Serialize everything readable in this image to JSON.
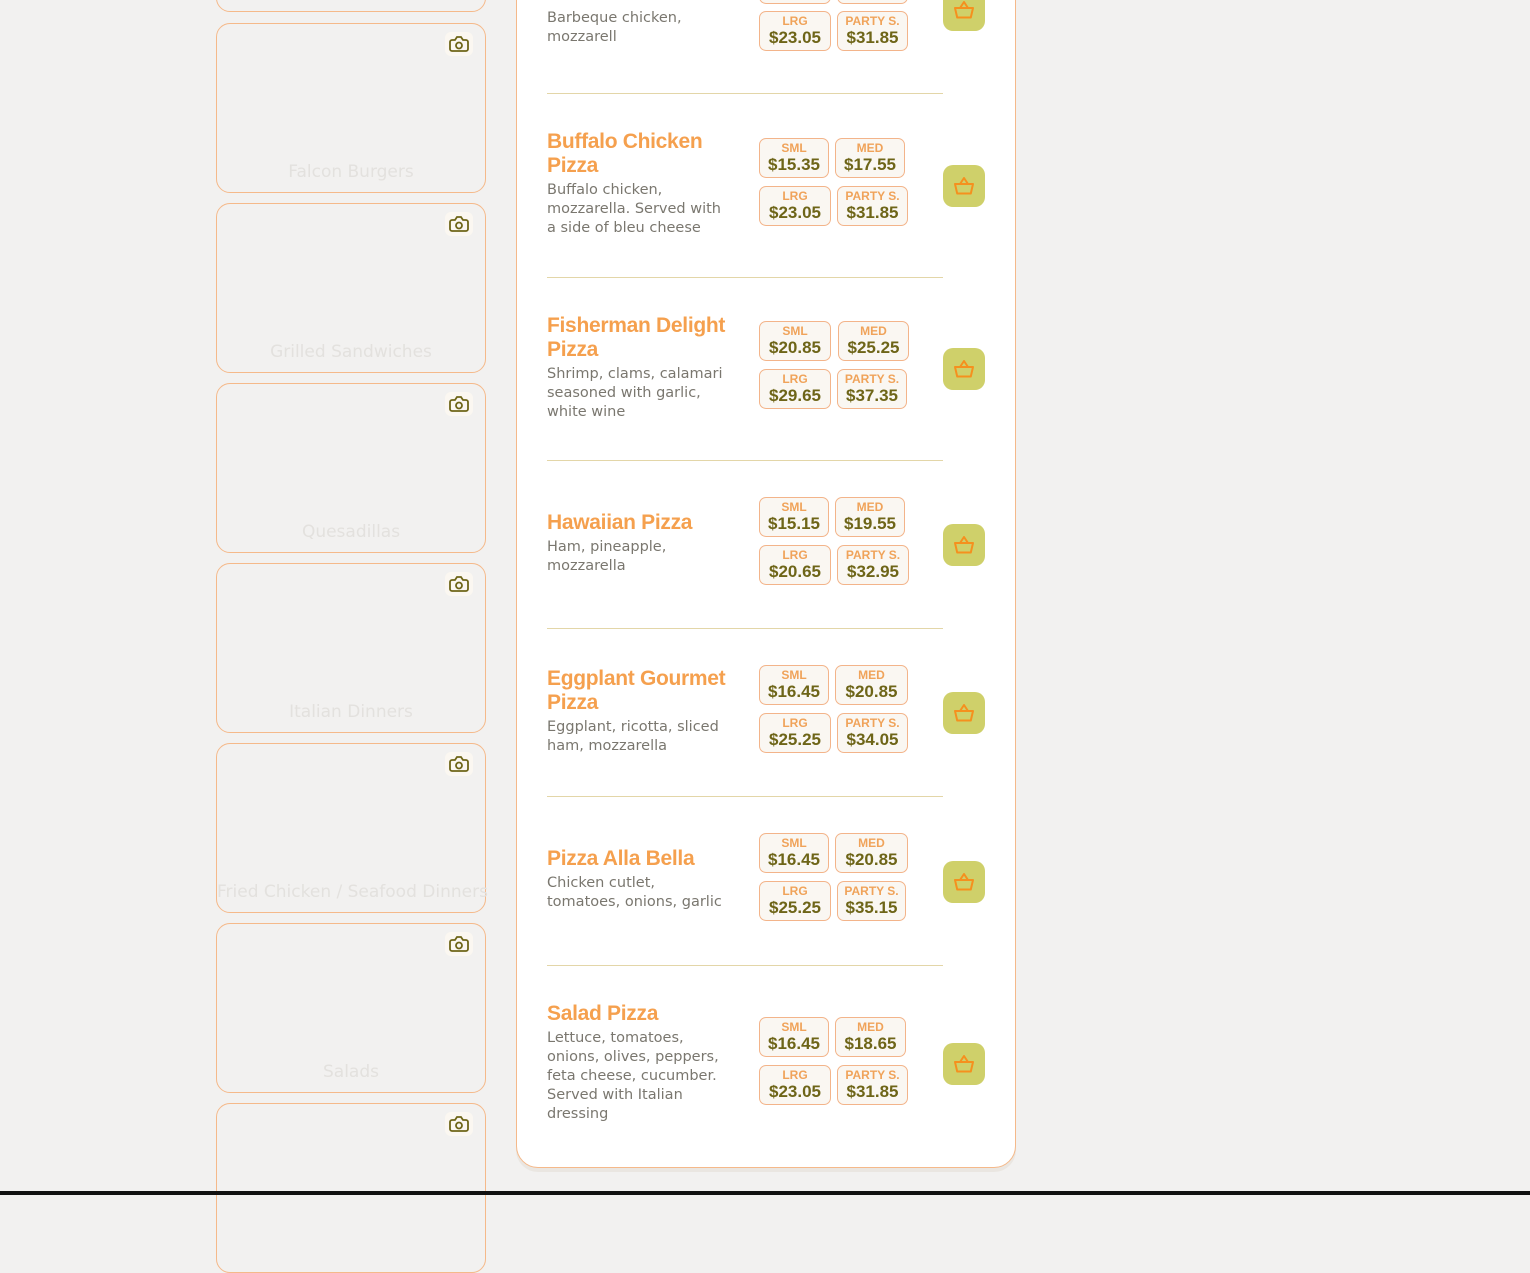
{
  "categories": [
    {
      "label": ""
    },
    {
      "label": "Falcon Burgers"
    },
    {
      "label": "Grilled Sandwiches"
    },
    {
      "label": "Quesadillas"
    },
    {
      "label": "Italian Dinners"
    },
    {
      "label": "Fried Chicken / Seafood Dinners"
    },
    {
      "label": "Salads"
    },
    {
      "label": ""
    }
  ],
  "menu_items": [
    {
      "name": "",
      "description": "Barbeque chicken, mozzarell",
      "prices": [
        {
          "size": "LRG",
          "price": "$23.05"
        },
        {
          "size": "PARTY S.",
          "price": "$31.85"
        }
      ]
    },
    {
      "name": "Buffalo Chicken Pizza",
      "description": "Buffalo chicken, mozzarella. Served with a side of bleu cheese",
      "prices": [
        {
          "size": "SML",
          "price": "$15.35"
        },
        {
          "size": "MED",
          "price": "$17.55"
        },
        {
          "size": "LRG",
          "price": "$23.05"
        },
        {
          "size": "PARTY S.",
          "price": "$31.85"
        }
      ]
    },
    {
      "name": "Fisherman Delight Pizza",
      "description": "Shrimp, clams, calamari seasoned with garlic, white wine",
      "prices": [
        {
          "size": "SML",
          "price": "$20.85"
        },
        {
          "size": "MED",
          "price": "$25.25"
        },
        {
          "size": "LRG",
          "price": "$29.65"
        },
        {
          "size": "PARTY S.",
          "price": "$37.35"
        }
      ]
    },
    {
      "name": "Hawaiian Pizza",
      "description": "Ham, pineapple, mozzarella",
      "prices": [
        {
          "size": "SML",
          "price": "$15.15"
        },
        {
          "size": "MED",
          "price": "$19.55"
        },
        {
          "size": "LRG",
          "price": "$20.65"
        },
        {
          "size": "PARTY S.",
          "price": "$32.95"
        }
      ]
    },
    {
      "name": "Eggplant Gourmet Pizza",
      "description": "Eggplant, ricotta, sliced ham, mozzarella",
      "prices": [
        {
          "size": "SML",
          "price": "$16.45"
        },
        {
          "size": "MED",
          "price": "$20.85"
        },
        {
          "size": "LRG",
          "price": "$25.25"
        },
        {
          "size": "PARTY S.",
          "price": "$34.05"
        }
      ]
    },
    {
      "name": "Pizza Alla Bella",
      "description": "Chicken cutlet, tomatoes, onions, garlic",
      "prices": [
        {
          "size": "SML",
          "price": "$16.45"
        },
        {
          "size": "MED",
          "price": "$20.85"
        },
        {
          "size": "LRG",
          "price": "$25.25"
        },
        {
          "size": "PARTY S.",
          "price": "$35.15"
        }
      ]
    },
    {
      "name": "Salad Pizza",
      "description": "Lettuce, tomatoes, onions, olives, peppers, feta cheese, cucumber. Served with Italian dressing",
      "prices": [
        {
          "size": "SML",
          "price": "$16.45"
        },
        {
          "size": "MED",
          "price": "$18.65"
        },
        {
          "size": "LRG",
          "price": "$23.05"
        },
        {
          "size": "PARTY S.",
          "price": "$31.85"
        }
      ]
    }
  ],
  "icons": {
    "category_photo": "camera-icon",
    "add_to_cart": "basket-icon"
  },
  "colors": {
    "accent_orange": "#f5a04e",
    "price_text": "#6e6518",
    "cart_button": "#cfd06a",
    "card_border": "#f5b98a"
  }
}
